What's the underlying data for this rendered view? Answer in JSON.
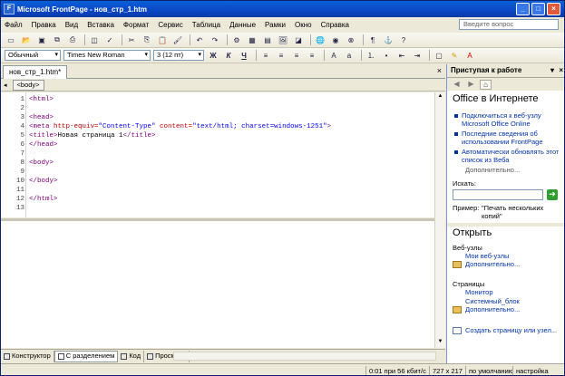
{
  "window": {
    "title": "Microsoft FrontPage - нов_стр_1.htm",
    "icon": "frontpage-icon"
  },
  "menu": {
    "items": [
      "Файл",
      "Правка",
      "Вид",
      "Вставка",
      "Формат",
      "Сервис",
      "Таблица",
      "Данные",
      "Рамки",
      "Окно",
      "Справка"
    ],
    "question_placeholder": "Введите вопрос"
  },
  "format_toolbar": {
    "style": "Обычный",
    "font": "Times New Roman",
    "size": "3  (12 пт)"
  },
  "document": {
    "tab_label": "нов_стр_1.htm*",
    "tag_selector": "<body>"
  },
  "code": {
    "line_numbers": [
      "1",
      "2",
      "3",
      "4",
      "5",
      "6",
      "7",
      "8",
      "9",
      "10",
      "11",
      "12",
      "13"
    ],
    "l1": "<html>",
    "l3": "<head>",
    "l4_tag": "<meta ",
    "l4_a1": "http-equiv=",
    "l4_v1": "\"Content-Type\"",
    "l4_a2": " content=",
    "l4_v2": "\"text/html; charset=windows-1251\"",
    "l4_end": ">",
    "l5_open": "<title>",
    "l5_text": "Новая страница 1",
    "l5_close": "</title>",
    "l6": "</head>",
    "l8": "<body>",
    "l10": "</body>",
    "l12": "</html>"
  },
  "views": [
    "Конструктор",
    "С разделением",
    "Код",
    "Просмотр"
  ],
  "status": {
    "speed": "0:01 при 56 кбит/с",
    "size": "727 x 217",
    "default": "по умолчанию",
    "custom": "настройка"
  },
  "task_pane": {
    "title": "Приступая к работе",
    "office_heading": "Office в Интернете",
    "bullets": [
      "Подключиться к веб-узлу Microsoft Office Online",
      "Последние сведения об использовании FrontPage",
      "Автоматически обновлять этот список из Веба"
    ],
    "more1": "Дополнительно...",
    "search_label": "Искать:",
    "example_label": "Пример:",
    "example_text": "\"Печать нескольких копий\"",
    "open_heading": "Открыть",
    "websites_label": "Веб-узлы",
    "my_websites": "Мои веб-узлы",
    "more2": "Дополнительно...",
    "pages_label": "Страницы",
    "page1": "Монитор",
    "page2": "Системный_блок",
    "more3": "Дополнительно...",
    "create_link": "Создать страницу или узел..."
  },
  "colors": {
    "title_bar": "#0b46c6",
    "tag": "#800080",
    "attr": "#c00000",
    "value": "#0000ff",
    "link": "#0033aa"
  }
}
